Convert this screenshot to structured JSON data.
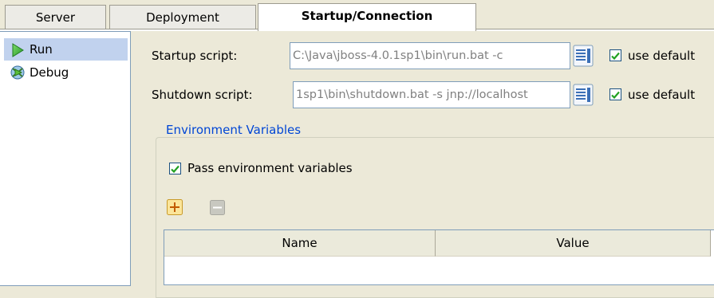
{
  "tabs": [
    {
      "label": "Server"
    },
    {
      "label": "Deployment"
    },
    {
      "label": "Startup/Connection"
    }
  ],
  "sidebar": {
    "items": [
      {
        "label": "Run",
        "icon": "play-icon",
        "selected": true
      },
      {
        "label": "Debug",
        "icon": "debug-icon",
        "selected": false
      }
    ]
  },
  "startup": {
    "label": "Startup script:",
    "value": "C:\\Java\\jboss-4.0.1sp1\\bin\\run.bat -c",
    "use_default_label": "use default",
    "use_default_checked": true
  },
  "shutdown": {
    "label": "Shutdown script:",
    "value": "1sp1\\bin\\shutdown.bat -s jnp://localhost",
    "use_default_label": "use default",
    "use_default_checked": true
  },
  "env": {
    "group_title": "Environment Variables",
    "pass_label": "Pass environment variables",
    "pass_checked": true,
    "table_headers": [
      "Name",
      "Value"
    ]
  },
  "colors": {
    "accent_blue": "#0046d5",
    "selected_bg": "#c1d2ee"
  }
}
